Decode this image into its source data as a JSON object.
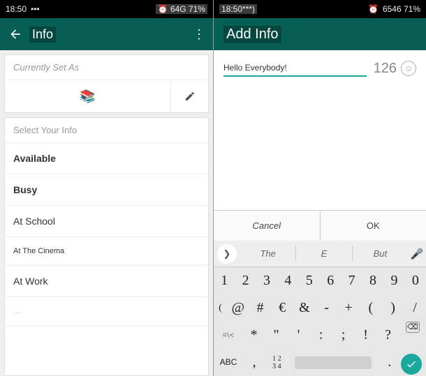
{
  "left": {
    "status": {
      "time": "18:50",
      "dots": "•••",
      "alarm": "⏰",
      "net": "64G 71%"
    },
    "header": {
      "title": "Info"
    },
    "currentlySetAs": "Currently Set As",
    "selectYourInfo": "Select Your Info",
    "options": [
      {
        "label": "Available",
        "bold": true
      },
      {
        "label": "Busy",
        "bold": true
      },
      {
        "label": "At School",
        "bold": false
      },
      {
        "label": "At The Cinema",
        "bold": false,
        "small": true
      },
      {
        "label": "At Work",
        "bold": false
      }
    ]
  },
  "right": {
    "status": {
      "time": "18:50***)",
      "alarm": "⏰",
      "net": "6546 71%"
    },
    "header": {
      "title": "Add Info"
    },
    "input": {
      "value": "Hello Everybody!",
      "count": "126"
    },
    "cancel": "Cancel",
    "ok": "OK",
    "suggestions": [
      "The",
      "E",
      "But"
    ],
    "row1": [
      "1",
      "2",
      "3",
      "4",
      "5",
      "6",
      "7",
      "8",
      "9",
      "0"
    ],
    "row2": [
      "@",
      "#",
      "€",
      "&",
      "-",
      "+",
      "(",
      ")",
      "/"
    ],
    "row3": [
      "=\\<",
      "*",
      "\"",
      "'",
      ":",
      ";",
      "!",
      "?"
    ],
    "row4": {
      "abc": "ABC",
      "comma": ",",
      "nums": "1 2\n3 4",
      "dot": "."
    }
  }
}
